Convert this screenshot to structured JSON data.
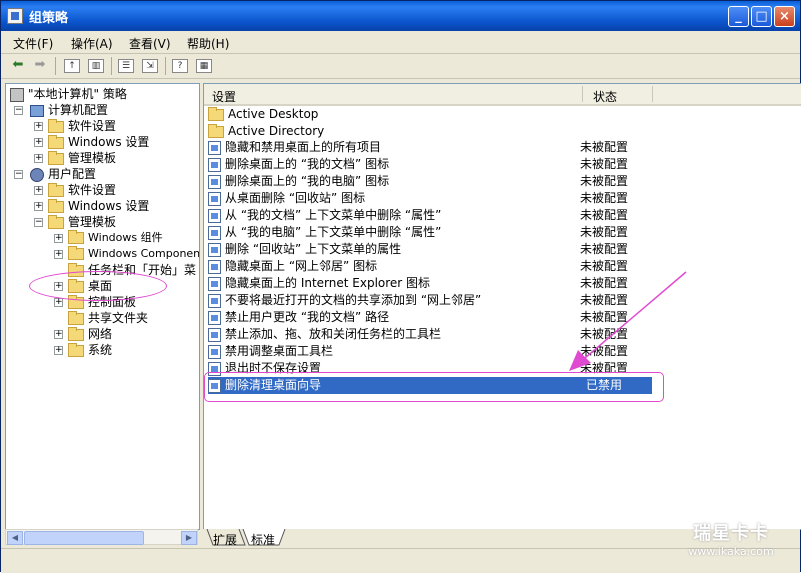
{
  "window": {
    "title": "组策略",
    "min_glyph": "_",
    "max_glyph": "□",
    "close_glyph": "×"
  },
  "menu": [
    {
      "label": "文件(F)"
    },
    {
      "label": "操作(A)"
    },
    {
      "label": "查看(V)"
    },
    {
      "label": "帮助(H)"
    }
  ],
  "tree": {
    "root": "\"本地计算机\" 策略",
    "computer": "计算机配置",
    "computer_children": [
      "软件设置",
      "Windows 设置",
      "管理模板"
    ],
    "user": "用户配置",
    "user_children": [
      "软件设置",
      "Windows 设置",
      "管理模板"
    ],
    "admin_children": [
      "Windows 组件",
      "Windows Components",
      "任务栏和「开始」菜",
      "桌面",
      "控制面板",
      "共享文件夹",
      "网络",
      "系统"
    ]
  },
  "list": {
    "col_setting": "设置",
    "col_state": "状态",
    "folders": [
      "Active Desktop",
      "Active Directory"
    ],
    "items": [
      {
        "name": "隐藏和禁用桌面上的所有项目",
        "state": "未被配置"
      },
      {
        "name": "删除桌面上的 “我的文档” 图标",
        "state": "未被配置"
      },
      {
        "name": "删除桌面上的 “我的电脑” 图标",
        "state": "未被配置"
      },
      {
        "name": "从桌面删除 “回收站” 图标",
        "state": "未被配置"
      },
      {
        "name": "从 “我的文档” 上下文菜单中删除 “属性”",
        "state": "未被配置"
      },
      {
        "name": "从 “我的电脑” 上下文菜单中删除 “属性”",
        "state": "未被配置"
      },
      {
        "name": "删除 “回收站” 上下文菜单的属性",
        "state": "未被配置"
      },
      {
        "name": "隐藏桌面上 “网上邻居” 图标",
        "state": "未被配置"
      },
      {
        "name": "隐藏桌面上的 Internet Explorer 图标",
        "state": "未被配置"
      },
      {
        "name": "不要将最近打开的文档的共享添加到 “网上邻居”",
        "state": "未被配置"
      },
      {
        "name": "禁止用户更改 “我的文档” 路径",
        "state": "未被配置"
      },
      {
        "name": "禁止添加、拖、放和关闭任务栏的工具栏",
        "state": "未被配置"
      },
      {
        "name": "禁用调整桌面工具栏",
        "state": "未被配置"
      },
      {
        "name": "退出时不保存设置",
        "state": "未被配置"
      },
      {
        "name": "删除清理桌面向导",
        "state": "已禁用"
      }
    ]
  },
  "tabs": {
    "extended": "扩展",
    "standard": "标准"
  },
  "watermark": {
    "line1": "瑞星卡卡",
    "line2": "www.ikaka.com"
  },
  "colors": {
    "selection": "#316ac5",
    "annotation": "#e04ad0"
  }
}
